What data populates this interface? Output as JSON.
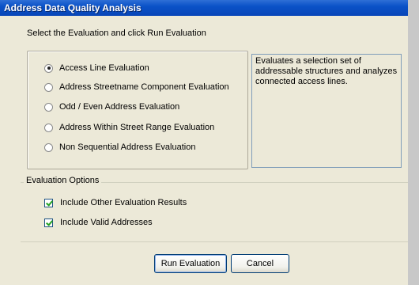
{
  "window": {
    "title": "Address Data Quality Analysis"
  },
  "instruction": "Select the Evaluation and click Run Evaluation",
  "evaluations": [
    {
      "label": "Access Line Evaluation",
      "selected": true
    },
    {
      "label": "Address Streetname Component Evaluation",
      "selected": false
    },
    {
      "label": "Odd / Even Address Evaluation",
      "selected": false
    },
    {
      "label": "Address Within Street Range Evaluation",
      "selected": false
    },
    {
      "label": "Non Sequential Address Evaluation",
      "selected": false
    }
  ],
  "description": "Evaluates a selection set of addressable structures and analyzes connected access lines.",
  "options": {
    "label": "Evaluation Options",
    "items": [
      {
        "label": "Include Other Evaluation Results",
        "checked": true
      },
      {
        "label": "Include Valid Addresses",
        "checked": true
      }
    ]
  },
  "buttons": {
    "run": "Run Evaluation",
    "cancel": "Cancel"
  }
}
